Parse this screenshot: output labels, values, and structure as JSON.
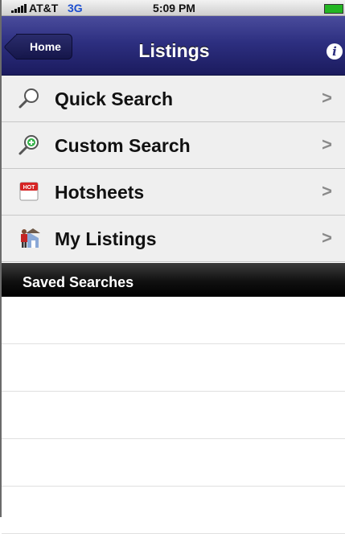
{
  "status_bar": {
    "carrier": "AT&T",
    "network": "3G",
    "time": "5:09 PM",
    "signal_icon": "signal-bars",
    "battery_icon": "battery"
  },
  "nav": {
    "back_label": "Home",
    "title": "Listings",
    "info_icon": "info-icon"
  },
  "menu": {
    "items": [
      {
        "label": "Quick Search",
        "icon": "magnifier-icon"
      },
      {
        "label": "Custom Search",
        "icon": "magnifier-plus-icon"
      },
      {
        "label": "Hotsheets",
        "icon": "hot-calendar-icon"
      },
      {
        "label": "My Listings",
        "icon": "agent-house-icon"
      }
    ],
    "chevron": ">"
  },
  "saved_searches": {
    "header": "Saved Searches",
    "rows": [
      "",
      "",
      "",
      "",
      ""
    ]
  },
  "colors": {
    "nav_bar": "#2d2f80",
    "network_text": "#1d4fd0",
    "row_bg": "#efefef",
    "section_header": "#000000"
  }
}
